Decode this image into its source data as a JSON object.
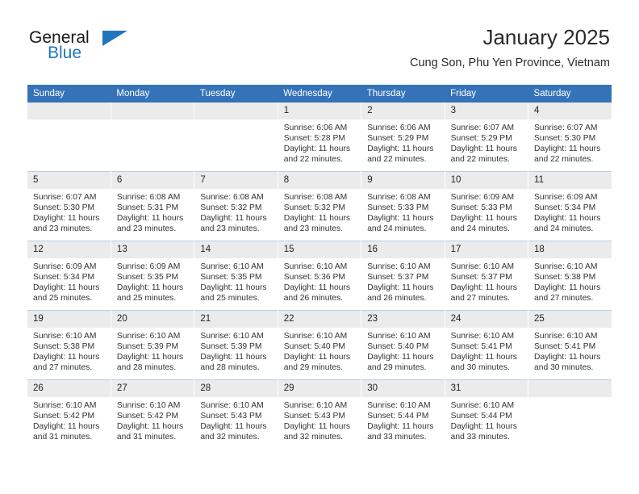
{
  "brand": {
    "name_part1": "General",
    "name_part2": "Blue",
    "accent_color": "#1f76bc"
  },
  "header": {
    "title": "January 2025",
    "location": "Cung Son, Phu Yen Province, Vietnam"
  },
  "theme": {
    "header_row_bg": "#3573b9",
    "daynum_bg": "#ebebeb",
    "grid_line": "#b9cde4"
  },
  "weekday_headers": [
    "Sunday",
    "Monday",
    "Tuesday",
    "Wednesday",
    "Thursday",
    "Friday",
    "Saturday"
  ],
  "labels": {
    "sunrise_prefix": "Sunrise:",
    "sunset_prefix": "Sunset:",
    "daylight_prefix": "Daylight:"
  },
  "weeks": [
    [
      {
        "day": "",
        "sunrise": "",
        "sunset": "",
        "daylight_line1": "",
        "daylight_line2": ""
      },
      {
        "day": "",
        "sunrise": "",
        "sunset": "",
        "daylight_line1": "",
        "daylight_line2": ""
      },
      {
        "day": "",
        "sunrise": "",
        "sunset": "",
        "daylight_line1": "",
        "daylight_line2": ""
      },
      {
        "day": "1",
        "sunrise": "Sunrise: 6:06 AM",
        "sunset": "Sunset: 5:28 PM",
        "daylight_line1": "Daylight: 11 hours",
        "daylight_line2": "and 22 minutes."
      },
      {
        "day": "2",
        "sunrise": "Sunrise: 6:06 AM",
        "sunset": "Sunset: 5:29 PM",
        "daylight_line1": "Daylight: 11 hours",
        "daylight_line2": "and 22 minutes."
      },
      {
        "day": "3",
        "sunrise": "Sunrise: 6:07 AM",
        "sunset": "Sunset: 5:29 PM",
        "daylight_line1": "Daylight: 11 hours",
        "daylight_line2": "and 22 minutes."
      },
      {
        "day": "4",
        "sunrise": "Sunrise: 6:07 AM",
        "sunset": "Sunset: 5:30 PM",
        "daylight_line1": "Daylight: 11 hours",
        "daylight_line2": "and 22 minutes."
      }
    ],
    [
      {
        "day": "5",
        "sunrise": "Sunrise: 6:07 AM",
        "sunset": "Sunset: 5:30 PM",
        "daylight_line1": "Daylight: 11 hours",
        "daylight_line2": "and 23 minutes."
      },
      {
        "day": "6",
        "sunrise": "Sunrise: 6:08 AM",
        "sunset": "Sunset: 5:31 PM",
        "daylight_line1": "Daylight: 11 hours",
        "daylight_line2": "and 23 minutes."
      },
      {
        "day": "7",
        "sunrise": "Sunrise: 6:08 AM",
        "sunset": "Sunset: 5:32 PM",
        "daylight_line1": "Daylight: 11 hours",
        "daylight_line2": "and 23 minutes."
      },
      {
        "day": "8",
        "sunrise": "Sunrise: 6:08 AM",
        "sunset": "Sunset: 5:32 PM",
        "daylight_line1": "Daylight: 11 hours",
        "daylight_line2": "and 23 minutes."
      },
      {
        "day": "9",
        "sunrise": "Sunrise: 6:08 AM",
        "sunset": "Sunset: 5:33 PM",
        "daylight_line1": "Daylight: 11 hours",
        "daylight_line2": "and 24 minutes."
      },
      {
        "day": "10",
        "sunrise": "Sunrise: 6:09 AM",
        "sunset": "Sunset: 5:33 PM",
        "daylight_line1": "Daylight: 11 hours",
        "daylight_line2": "and 24 minutes."
      },
      {
        "day": "11",
        "sunrise": "Sunrise: 6:09 AM",
        "sunset": "Sunset: 5:34 PM",
        "daylight_line1": "Daylight: 11 hours",
        "daylight_line2": "and 24 minutes."
      }
    ],
    [
      {
        "day": "12",
        "sunrise": "Sunrise: 6:09 AM",
        "sunset": "Sunset: 5:34 PM",
        "daylight_line1": "Daylight: 11 hours",
        "daylight_line2": "and 25 minutes."
      },
      {
        "day": "13",
        "sunrise": "Sunrise: 6:09 AM",
        "sunset": "Sunset: 5:35 PM",
        "daylight_line1": "Daylight: 11 hours",
        "daylight_line2": "and 25 minutes."
      },
      {
        "day": "14",
        "sunrise": "Sunrise: 6:10 AM",
        "sunset": "Sunset: 5:35 PM",
        "daylight_line1": "Daylight: 11 hours",
        "daylight_line2": "and 25 minutes."
      },
      {
        "day": "15",
        "sunrise": "Sunrise: 6:10 AM",
        "sunset": "Sunset: 5:36 PM",
        "daylight_line1": "Daylight: 11 hours",
        "daylight_line2": "and 26 minutes."
      },
      {
        "day": "16",
        "sunrise": "Sunrise: 6:10 AM",
        "sunset": "Sunset: 5:37 PM",
        "daylight_line1": "Daylight: 11 hours",
        "daylight_line2": "and 26 minutes."
      },
      {
        "day": "17",
        "sunrise": "Sunrise: 6:10 AM",
        "sunset": "Sunset: 5:37 PM",
        "daylight_line1": "Daylight: 11 hours",
        "daylight_line2": "and 27 minutes."
      },
      {
        "day": "18",
        "sunrise": "Sunrise: 6:10 AM",
        "sunset": "Sunset: 5:38 PM",
        "daylight_line1": "Daylight: 11 hours",
        "daylight_line2": "and 27 minutes."
      }
    ],
    [
      {
        "day": "19",
        "sunrise": "Sunrise: 6:10 AM",
        "sunset": "Sunset: 5:38 PM",
        "daylight_line1": "Daylight: 11 hours",
        "daylight_line2": "and 27 minutes."
      },
      {
        "day": "20",
        "sunrise": "Sunrise: 6:10 AM",
        "sunset": "Sunset: 5:39 PM",
        "daylight_line1": "Daylight: 11 hours",
        "daylight_line2": "and 28 minutes."
      },
      {
        "day": "21",
        "sunrise": "Sunrise: 6:10 AM",
        "sunset": "Sunset: 5:39 PM",
        "daylight_line1": "Daylight: 11 hours",
        "daylight_line2": "and 28 minutes."
      },
      {
        "day": "22",
        "sunrise": "Sunrise: 6:10 AM",
        "sunset": "Sunset: 5:40 PM",
        "daylight_line1": "Daylight: 11 hours",
        "daylight_line2": "and 29 minutes."
      },
      {
        "day": "23",
        "sunrise": "Sunrise: 6:10 AM",
        "sunset": "Sunset: 5:40 PM",
        "daylight_line1": "Daylight: 11 hours",
        "daylight_line2": "and 29 minutes."
      },
      {
        "day": "24",
        "sunrise": "Sunrise: 6:10 AM",
        "sunset": "Sunset: 5:41 PM",
        "daylight_line1": "Daylight: 11 hours",
        "daylight_line2": "and 30 minutes."
      },
      {
        "day": "25",
        "sunrise": "Sunrise: 6:10 AM",
        "sunset": "Sunset: 5:41 PM",
        "daylight_line1": "Daylight: 11 hours",
        "daylight_line2": "and 30 minutes."
      }
    ],
    [
      {
        "day": "26",
        "sunrise": "Sunrise: 6:10 AM",
        "sunset": "Sunset: 5:42 PM",
        "daylight_line1": "Daylight: 11 hours",
        "daylight_line2": "and 31 minutes."
      },
      {
        "day": "27",
        "sunrise": "Sunrise: 6:10 AM",
        "sunset": "Sunset: 5:42 PM",
        "daylight_line1": "Daylight: 11 hours",
        "daylight_line2": "and 31 minutes."
      },
      {
        "day": "28",
        "sunrise": "Sunrise: 6:10 AM",
        "sunset": "Sunset: 5:43 PM",
        "daylight_line1": "Daylight: 11 hours",
        "daylight_line2": "and 32 minutes."
      },
      {
        "day": "29",
        "sunrise": "Sunrise: 6:10 AM",
        "sunset": "Sunset: 5:43 PM",
        "daylight_line1": "Daylight: 11 hours",
        "daylight_line2": "and 32 minutes."
      },
      {
        "day": "30",
        "sunrise": "Sunrise: 6:10 AM",
        "sunset": "Sunset: 5:44 PM",
        "daylight_line1": "Daylight: 11 hours",
        "daylight_line2": "and 33 minutes."
      },
      {
        "day": "31",
        "sunrise": "Sunrise: 6:10 AM",
        "sunset": "Sunset: 5:44 PM",
        "daylight_line1": "Daylight: 11 hours",
        "daylight_line2": "and 33 minutes."
      },
      {
        "day": "",
        "sunrise": "",
        "sunset": "",
        "daylight_line1": "",
        "daylight_line2": ""
      }
    ]
  ]
}
